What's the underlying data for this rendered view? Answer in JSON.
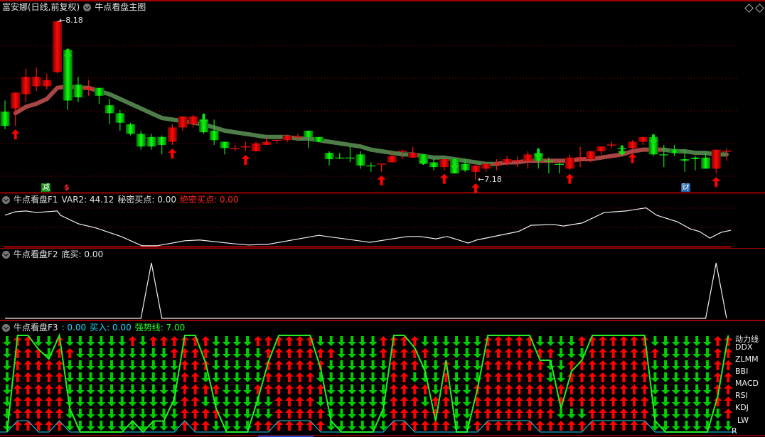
{
  "main": {
    "security_title": "富安娜(日线,前复权)",
    "indicator_name": "牛点看盘主图",
    "high_label": "8.18",
    "low_label": "7.18",
    "high_bar": 5,
    "low_bar": 45,
    "price_range": [
      7.18,
      8.18
    ],
    "tags": [
      {
        "text": "减",
        "bar": 4,
        "color": "#0a8a0a"
      },
      {
        "text": "$",
        "bar": 6,
        "color": "#ff2020"
      },
      {
        "text": "财",
        "bar": 65,
        "color": "#1a5fa8"
      }
    ],
    "candles": [
      [
        7.61,
        7.68,
        7.5,
        7.52
      ],
      [
        7.63,
        7.73,
        7.52,
        7.73
      ],
      [
        7.72,
        7.88,
        7.67,
        7.83
      ],
      [
        7.77,
        7.89,
        7.74,
        7.83
      ],
      [
        7.77,
        7.85,
        7.75,
        7.81
      ],
      [
        7.86,
        8.18,
        7.85,
        8.18
      ],
      [
        8.0,
        8.01,
        7.62,
        7.68
      ],
      [
        7.78,
        7.83,
        7.67,
        7.7
      ],
      [
        7.76,
        7.81,
        7.71,
        7.76
      ],
      [
        7.76,
        7.76,
        7.66,
        7.71
      ],
      [
        7.65,
        7.69,
        7.53,
        7.6
      ],
      [
        7.6,
        7.62,
        7.49,
        7.54
      ],
      [
        7.53,
        7.54,
        7.46,
        7.47
      ],
      [
        7.47,
        7.49,
        7.37,
        7.39
      ],
      [
        7.45,
        7.47,
        7.37,
        7.39
      ],
      [
        7.45,
        7.46,
        7.34,
        7.4
      ],
      [
        7.42,
        7.53,
        7.4,
        7.51
      ],
      [
        7.51,
        7.58,
        7.49,
        7.58
      ],
      [
        7.53,
        7.59,
        7.51,
        7.58
      ],
      [
        7.56,
        7.6,
        7.47,
        7.48
      ],
      [
        7.49,
        7.56,
        7.4,
        7.43
      ],
      [
        7.42,
        7.42,
        7.34,
        7.38
      ],
      [
        7.38,
        7.4,
        7.36,
        7.38
      ],
      [
        7.385,
        7.42,
        7.36,
        7.39
      ],
      [
        7.36,
        7.42,
        7.36,
        7.41
      ],
      [
        7.4,
        7.45,
        7.4,
        7.42
      ],
      [
        7.43,
        7.43,
        7.41,
        7.432
      ],
      [
        7.43,
        7.46,
        7.42,
        7.46
      ],
      [
        7.45,
        7.47,
        7.43,
        7.452
      ],
      [
        7.49,
        7.49,
        7.38,
        7.45
      ],
      [
        7.45,
        7.45,
        7.42,
        7.42
      ],
      [
        7.35,
        7.36,
        7.27,
        7.31
      ],
      [
        7.32,
        7.35,
        7.31,
        7.318
      ],
      [
        7.32,
        7.39,
        7.29,
        7.318
      ],
      [
        7.34,
        7.36,
        7.25,
        7.27
      ],
      [
        7.27,
        7.29,
        7.23,
        7.268
      ],
      [
        7.28,
        7.28,
        7.23,
        7.282
      ],
      [
        7.29,
        7.36,
        7.29,
        7.33
      ],
      [
        7.36,
        7.37,
        7.31,
        7.362
      ],
      [
        7.32,
        7.39,
        7.32,
        7.35
      ],
      [
        7.34,
        7.34,
        7.28,
        7.28
      ],
      [
        7.29,
        7.31,
        7.24,
        7.26
      ],
      [
        7.26,
        7.31,
        7.24,
        7.31
      ],
      [
        7.31,
        7.31,
        7.22,
        7.22
      ],
      [
        7.28,
        7.31,
        7.23,
        7.24
      ],
      [
        7.23,
        7.27,
        7.18,
        7.27
      ],
      [
        7.25,
        7.29,
        7.23,
        7.28
      ],
      [
        7.28,
        7.31,
        7.24,
        7.282
      ],
      [
        7.29,
        7.33,
        7.27,
        7.31
      ],
      [
        7.3,
        7.33,
        7.26,
        7.302
      ],
      [
        7.3,
        7.36,
        7.25,
        7.34
      ],
      [
        7.35,
        7.38,
        7.25,
        7.3
      ],
      [
        7.3,
        7.32,
        7.22,
        7.298
      ],
      [
        7.28,
        7.29,
        7.22,
        7.278
      ],
      [
        7.25,
        7.34,
        7.24,
        7.32
      ],
      [
        7.32,
        7.39,
        7.26,
        7.322
      ],
      [
        7.31,
        7.36,
        7.29,
        7.36
      ],
      [
        7.36,
        7.39,
        7.34,
        7.39
      ],
      [
        7.4,
        7.42,
        7.38,
        7.402
      ],
      [
        7.38,
        7.4,
        7.37,
        7.378
      ],
      [
        7.38,
        7.43,
        7.37,
        7.42
      ],
      [
        7.42,
        7.45,
        7.4,
        7.45
      ],
      [
        7.45,
        7.47,
        7.33,
        7.34
      ],
      [
        7.34,
        7.4,
        7.26,
        7.338
      ],
      [
        7.37,
        7.4,
        7.33,
        7.35
      ],
      [
        7.31,
        7.37,
        7.23,
        7.3
      ],
      [
        7.32,
        7.33,
        7.24,
        7.31
      ],
      [
        7.32,
        7.35,
        7.25,
        7.25
      ],
      [
        7.25,
        7.37,
        7.22,
        7.37
      ],
      [
        7.36,
        7.38,
        7.3,
        7.362
      ]
    ],
    "ma": [
      null,
      7.6,
      7.64,
      7.66,
      7.69,
      7.76,
      7.77,
      7.76,
      7.76,
      7.74,
      7.72,
      7.69,
      7.66,
      7.63,
      7.6,
      7.57,
      7.56,
      7.55,
      7.54,
      7.53,
      7.51,
      7.49,
      7.48,
      7.47,
      7.46,
      7.45,
      7.45,
      7.45,
      7.44,
      7.44,
      7.43,
      7.42,
      7.41,
      7.4,
      7.39,
      7.37,
      7.36,
      7.35,
      7.34,
      7.34,
      7.33,
      7.32,
      7.32,
      7.31,
      7.3,
      7.29,
      7.28,
      7.28,
      7.29,
      7.29,
      7.3,
      7.3,
      7.3,
      7.3,
      7.3,
      7.31,
      7.31,
      7.32,
      7.33,
      7.34,
      7.36,
      7.37,
      7.37,
      7.37,
      7.36,
      7.36,
      7.35,
      7.35,
      7.34,
      7.34
    ],
    "ma_up_ranges": [
      [
        0,
        8
      ],
      [
        47,
        62
      ]
    ],
    "ma_colors": {
      "up": "#a84545",
      "down": "#4f7d4a"
    },
    "buy_arrows": [
      1,
      16,
      23,
      36,
      42,
      45,
      54,
      60,
      68
    ],
    "sell_arrows": [
      6,
      19,
      40,
      43,
      51,
      59,
      62
    ]
  },
  "f1": {
    "name": "牛点看盘F1",
    "var2": "VAR2: 44.12",
    "secret_buy": "秘密买点: 0.00",
    "top_secret_buy": "绝密买点: 0.00",
    "range": [
      0,
      100
    ],
    "points": [
      [
        0,
        81
      ],
      [
        1,
        90
      ],
      [
        2,
        92
      ],
      [
        3,
        88
      ],
      [
        5,
        92
      ],
      [
        5.3,
        81
      ],
      [
        7,
        59
      ],
      [
        8.7,
        48
      ],
      [
        11.1,
        26
      ],
      [
        13.1,
        2
      ],
      [
        14.5,
        2
      ],
      [
        17.2,
        15
      ],
      [
        18.6,
        17
      ],
      [
        22,
        7
      ],
      [
        23.3,
        4
      ],
      [
        25.2,
        6
      ],
      [
        30,
        29
      ],
      [
        33,
        18
      ],
      [
        34.9,
        11
      ],
      [
        38.5,
        26
      ],
      [
        39.7,
        26
      ],
      [
        41.2,
        20
      ],
      [
        42.3,
        26
      ],
      [
        44.3,
        9
      ],
      [
        45.1,
        17
      ],
      [
        49.1,
        39
      ],
      [
        50.3,
        55
      ],
      [
        52.5,
        57
      ],
      [
        53.4,
        53
      ],
      [
        55.2,
        61
      ],
      [
        57.3,
        88
      ],
      [
        59.4,
        92
      ],
      [
        61.3,
        100
      ],
      [
        62.3,
        81
      ],
      [
        64.3,
        64
      ],
      [
        65.5,
        46
      ],
      [
        66.4,
        39
      ],
      [
        67.4,
        22
      ],
      [
        68.5,
        37
      ],
      [
        69.4,
        42
      ]
    ]
  },
  "f2": {
    "name": "牛点看盘F2",
    "bottom_buy": "底买: 0.00",
    "spikes": [
      14,
      68
    ]
  },
  "f3": {
    "name": "牛点看盘F3",
    "value0": ": 0.00",
    "buy": "买入: 0.00",
    "strength": "强势线: 7.00",
    "row_labels": [
      "动力线",
      "DDX",
      "ZLMM",
      "BBI",
      "MACD",
      "RSI",
      "KDJ",
      "LW",
      "R"
    ],
    "grid": [
      "DDDDDDDD",
      "UUUUUUUU",
      "UUUUUUUU",
      "DUUUUUUU",
      "DDUUUUUU",
      "UUUUUUUU",
      "DUDDDDDD",
      "DDDDDDDD",
      "DDDDDDDD",
      "DDDDDDDD",
      "DDDDDDDD",
      "DDDDDDDD",
      "UDDDDDDD",
      "DDDDDDDD",
      "UDDDDDDD",
      "UDDDDDDD",
      "UUDDDDDD",
      "UUUUUUUU",
      "UUUUUUUU",
      "UUUDUDUU",
      "DDDDUDUD",
      "DDDDDDDD",
      "DDDDDDDD",
      "DDDDDDDD",
      "UDDDUDDU",
      "UUUUUDDU",
      "UUUUUUUU",
      "UUUUUUUU",
      "UUUUUUUU",
      "UUUUUUUU",
      "DUUDUDUU",
      "DUDDDDDD",
      "DDDDDDDD",
      "DDDDDDDD",
      "DDDDDDDD",
      "DDDDDDDD",
      "UUDDDDDD",
      "UUUUUUUU",
      "UUUUUUUU",
      "UUUDUUUU",
      "DUDDUDUU",
      "DDDDDUUU",
      "DDUUUUUU",
      "DDDDDDDD",
      "DDDDDDDD",
      "DDDDUUUU",
      "UUUUUUUU",
      "UUUUUUUU",
      "UUUUUUUU",
      "UUUUUUUU",
      "UUUUUUUU",
      "DUUUUUUU",
      "DUDDUUUU",
      "DDDDUUDU",
      "DDUUUUDU",
      "UDUUUUDU",
      "UUUUUUUU",
      "UUUUUUUU",
      "UUUUUUUU",
      "UUUUUUUU",
      "UUUUUUUU",
      "UUUUUUUU",
      "DUDDDDDD",
      "DDDDDDDD",
      "DDDDDDDD",
      "DDDDDDDD",
      "DDDDDDDD",
      "DDDDDDDD",
      "UUUUUUDD",
      "UUUUUUUD"
    ],
    "strength_line": [
      0,
      7,
      7,
      6,
      5.3,
      7,
      1.7,
      0,
      0,
      0,
      0,
      0,
      0.8,
      0,
      0.8,
      0.8,
      2.4,
      7,
      7,
      5,
      1.7,
      0,
      0,
      0,
      2.4,
      5.1,
      7,
      7,
      7,
      7,
      4.6,
      0.8,
      0,
      0,
      0,
      0,
      1.7,
      7,
      7,
      6.1,
      4.4,
      0.8,
      5.2,
      0,
      0,
      3.1,
      7,
      7,
      7,
      7,
      7,
      5.2,
      5.2,
      1.7,
      4.4,
      5.2,
      7,
      7,
      7,
      7,
      7,
      7,
      0.8,
      0,
      0,
      0,
      0,
      0,
      2.6,
      7
    ],
    "buy_line_on": [
      1,
      2,
      5,
      17,
      26,
      27,
      28,
      29,
      37,
      38,
      46,
      47,
      48,
      49,
      50,
      56,
      57,
      58,
      59,
      60,
      61
    ],
    "colors": {
      "up": "#ff0000",
      "down": "#00cc00",
      "strength": "#22ee22",
      "buy": "#20c8e8"
    }
  }
}
